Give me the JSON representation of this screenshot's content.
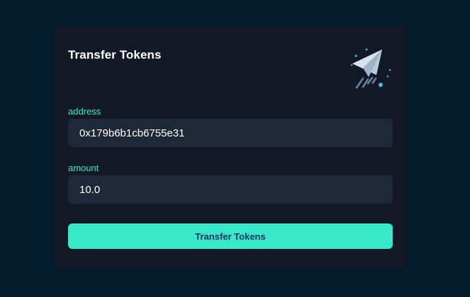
{
  "form": {
    "title": "Transfer Tokens",
    "icon": "paper-plane-icon",
    "address": {
      "label": "address",
      "value": "0x179b6b1cb6755e31"
    },
    "amount": {
      "label": "amount",
      "value": "10.0"
    },
    "submit_label": "Transfer Tokens"
  },
  "colors": {
    "background": "#041c2c",
    "card": "#121826",
    "input": "#1f2837",
    "accent": "#38e8c6",
    "label": "#3ee8c8",
    "button_text": "#24346a"
  }
}
